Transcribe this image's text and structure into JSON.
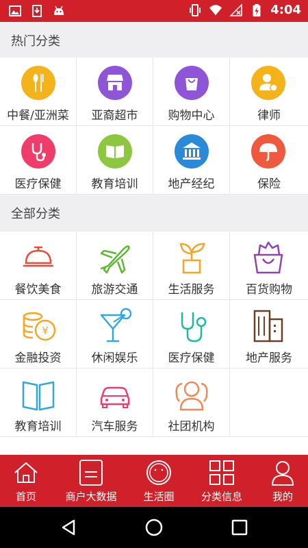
{
  "status_bar": {
    "time": "4:04",
    "left_icons": [
      "image-icon",
      "download-icon",
      "android-icon"
    ],
    "right_icons": [
      "vibrate-icon",
      "wifi-icon",
      "no-signal-icon",
      "battery-charging-icon"
    ]
  },
  "hot_section": {
    "title": "热门分类",
    "items": [
      {
        "label": "中餐/亚洲菜",
        "icon": "utensils-icon",
        "color": "#f5b31b"
      },
      {
        "label": "亚裔超市",
        "icon": "store-icon",
        "color": "#8e56d6"
      },
      {
        "label": "购物中心",
        "icon": "shopping-bag-icon",
        "color": "#8e56d6"
      },
      {
        "label": "律师",
        "icon": "lawyer-icon",
        "color": "#f5b31b"
      },
      {
        "label": "医疗保健",
        "icon": "stethoscope-icon",
        "color": "#ee3d6a"
      },
      {
        "label": "教育培训",
        "icon": "book-icon",
        "color": "#8dc63f"
      },
      {
        "label": "地产经纪",
        "icon": "bank-icon",
        "color": "#2a8ad8"
      },
      {
        "label": "保险",
        "icon": "umbrella-icon",
        "color": "#ef5a3f"
      }
    ]
  },
  "all_section": {
    "title": "全部分类",
    "items": [
      {
        "label": "餐饮美食",
        "icon": "food-cloche-icon",
        "color": "#e74c3c"
      },
      {
        "label": "旅游交通",
        "icon": "airplane-icon",
        "color": "#5cb82f"
      },
      {
        "label": "生活服务",
        "icon": "plant-pot-icon",
        "color": "#f5a623"
      },
      {
        "label": "百货购物",
        "icon": "shopping-basket-icon",
        "color": "#8e44ad"
      },
      {
        "label": "金融投资",
        "icon": "coins-icon",
        "color": "#f5a623"
      },
      {
        "label": "休闲娱乐",
        "icon": "cocktail-icon",
        "color": "#2fa8e0"
      },
      {
        "label": "医疗保健",
        "icon": "stethoscope-icon",
        "color": "#1abc9c"
      },
      {
        "label": "地产服务",
        "icon": "building-icon",
        "color": "#6b3e26"
      },
      {
        "label": "教育培训",
        "icon": "open-book-icon",
        "color": "#2fa8e0"
      },
      {
        "label": "汽车服务",
        "icon": "car-icon",
        "color": "#ee3d6a"
      },
      {
        "label": "社团机构",
        "icon": "group-icon",
        "color": "#ef8a55"
      }
    ]
  },
  "bottom_nav": {
    "items": [
      {
        "label": "首页",
        "icon": "home-icon"
      },
      {
        "label": "商户大数据",
        "icon": "document-icon"
      },
      {
        "label": "生活圈",
        "icon": "circle-face-icon"
      },
      {
        "label": "分类信息",
        "icon": "grid-icon"
      },
      {
        "label": "我的",
        "icon": "user-icon"
      }
    ]
  },
  "system_nav": {
    "buttons": [
      "back-icon",
      "home-circle-icon",
      "recents-icon"
    ]
  },
  "colors": {
    "brand_red": "#d0212b",
    "section_bg": "#efeff1"
  }
}
